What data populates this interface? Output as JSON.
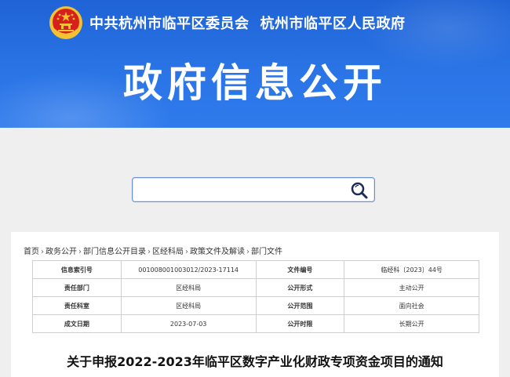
{
  "header": {
    "org_party": "中共杭州市临平区委员会",
    "org_gov": "杭州市临平区人民政府",
    "title": "政府信息公开",
    "emblem_icon": "national-emblem-icon",
    "colors": {
      "banner": "#2a74e6",
      "emblem_red": "#d6201c",
      "emblem_gold": "#f2c233"
    }
  },
  "search": {
    "value": "",
    "placeholder": "",
    "button_icon": "magnifier-icon"
  },
  "breadcrumb": [
    "首页",
    "政务公开",
    "部门信息公开目录",
    "区经科局",
    "政策文件及解读",
    "部门文件"
  ],
  "meta": {
    "rows": [
      {
        "k1": "信息索引号",
        "v1": "001008001003012/2023-17114",
        "k2": "文件编号",
        "v2": "临经科〔2023〕44号"
      },
      {
        "k1": "责任部门",
        "v1": "区经科局",
        "k2": "公开形式",
        "v2": "主动公开"
      },
      {
        "k1": "责任科室",
        "v1": "区经科局",
        "k2": "公开范围",
        "v2": "面向社会"
      },
      {
        "k1": "成文日期",
        "v1": "2023-07-03",
        "k2": "公开时限",
        "v2": "长期公开"
      }
    ]
  },
  "document": {
    "title": "关于申报2022-2023年临平区数字产业化财政专项资金项目的通知"
  }
}
